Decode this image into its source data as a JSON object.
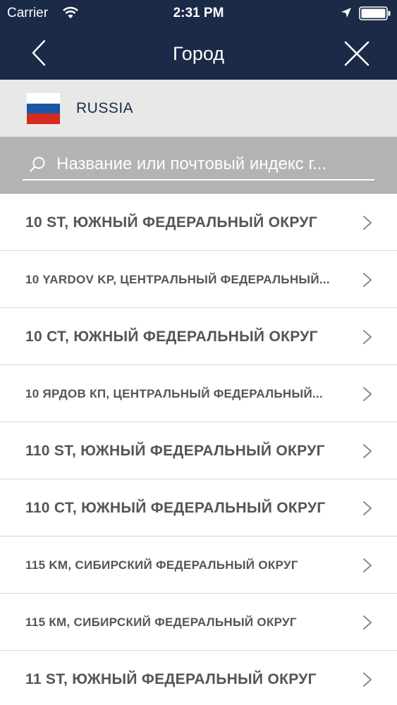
{
  "status_bar": {
    "carrier": "Carrier",
    "time": "2:31 PM",
    "icons": [
      "wifi-icon",
      "location-icon",
      "battery-icon"
    ]
  },
  "nav": {
    "title": "Город",
    "left_icon": "back-chevron-icon",
    "right_icon": "close-icon"
  },
  "country": {
    "name": "RUSSIA",
    "flag_colors": [
      "#ffffff",
      "#1c57a5",
      "#d52b1e"
    ]
  },
  "search": {
    "placeholder": "Название или почтовый индекс г..."
  },
  "cities": [
    {
      "label": "10 ST, ЮЖНЫЙ ФЕДЕРАЛЬНЫЙ ОКРУГ",
      "size": "large"
    },
    {
      "label": "10 YARDOV KP, ЦЕНТРАЛЬНЫЙ ФЕДЕРАЛЬНЫЙ...",
      "size": "small"
    },
    {
      "label": "10 СТ, ЮЖНЫЙ ФЕДЕРАЛЬНЫЙ ОКРУГ",
      "size": "large"
    },
    {
      "label": "10 ЯРДОВ КП, ЦЕНТРАЛЬНЫЙ ФЕДЕРАЛЬНЫЙ...",
      "size": "small"
    },
    {
      "label": "110 ST, ЮЖНЫЙ ФЕДЕРАЛЬНЫЙ ОКРУГ",
      "size": "large"
    },
    {
      "label": "110 СТ, ЮЖНЫЙ ФЕДЕРАЛЬНЫЙ ОКРУГ",
      "size": "large"
    },
    {
      "label": "115 KM, СИБИРСКИЙ ФЕДЕРАЛЬНЫЙ ОКРУГ",
      "size": "small"
    },
    {
      "label": "115 КМ, СИБИРСКИЙ ФЕДЕРАЛЬНЫЙ ОКРУГ",
      "size": "small"
    },
    {
      "label": "11 ST, ЮЖНЫЙ ФЕДЕРАЛЬНЫЙ ОКРУГ",
      "size": "large"
    }
  ],
  "colors": {
    "header_bg": "#1b2a47",
    "country_row_bg": "#e8e8e8",
    "search_bg": "#b3b3b3",
    "item_text": "#555555",
    "divider": "#d8d8d8"
  }
}
